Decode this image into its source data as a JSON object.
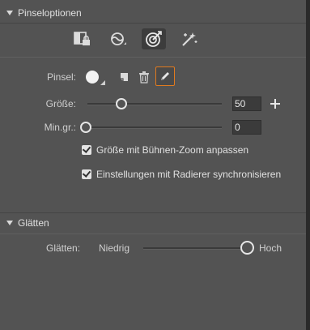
{
  "brush_options": {
    "header": "Pinseloptionen",
    "tools": [
      {
        "icon": "lock-layer-icon",
        "active": false
      },
      {
        "icon": "pressure-icon",
        "active": false
      },
      {
        "icon": "target-brush-icon",
        "active": true
      },
      {
        "icon": "magic-wand-icon",
        "active": false
      }
    ],
    "brush_label": "Pinsel:",
    "size_label": "Größe:",
    "size_value": "50",
    "size_fraction": 0.25,
    "min_size_label": "Min.gr.:",
    "min_size_value": "0",
    "min_size_fraction": 0.0,
    "checkbox_zoom": {
      "label": "Größe mit Bühnen-Zoom anpassen",
      "checked": true
    },
    "checkbox_eraser": {
      "label": "Einstellungen mit Radierer synchronisieren",
      "checked": true
    }
  },
  "smoothing": {
    "header": "Glätten",
    "label": "Glätten:",
    "low_label": "Niedrig",
    "high_label": "Hoch",
    "value_fraction": 1.0
  },
  "colors": {
    "panel_bg": "#535353",
    "accent_orange": "#e07a1f",
    "thumb": "#e6e6e6"
  }
}
